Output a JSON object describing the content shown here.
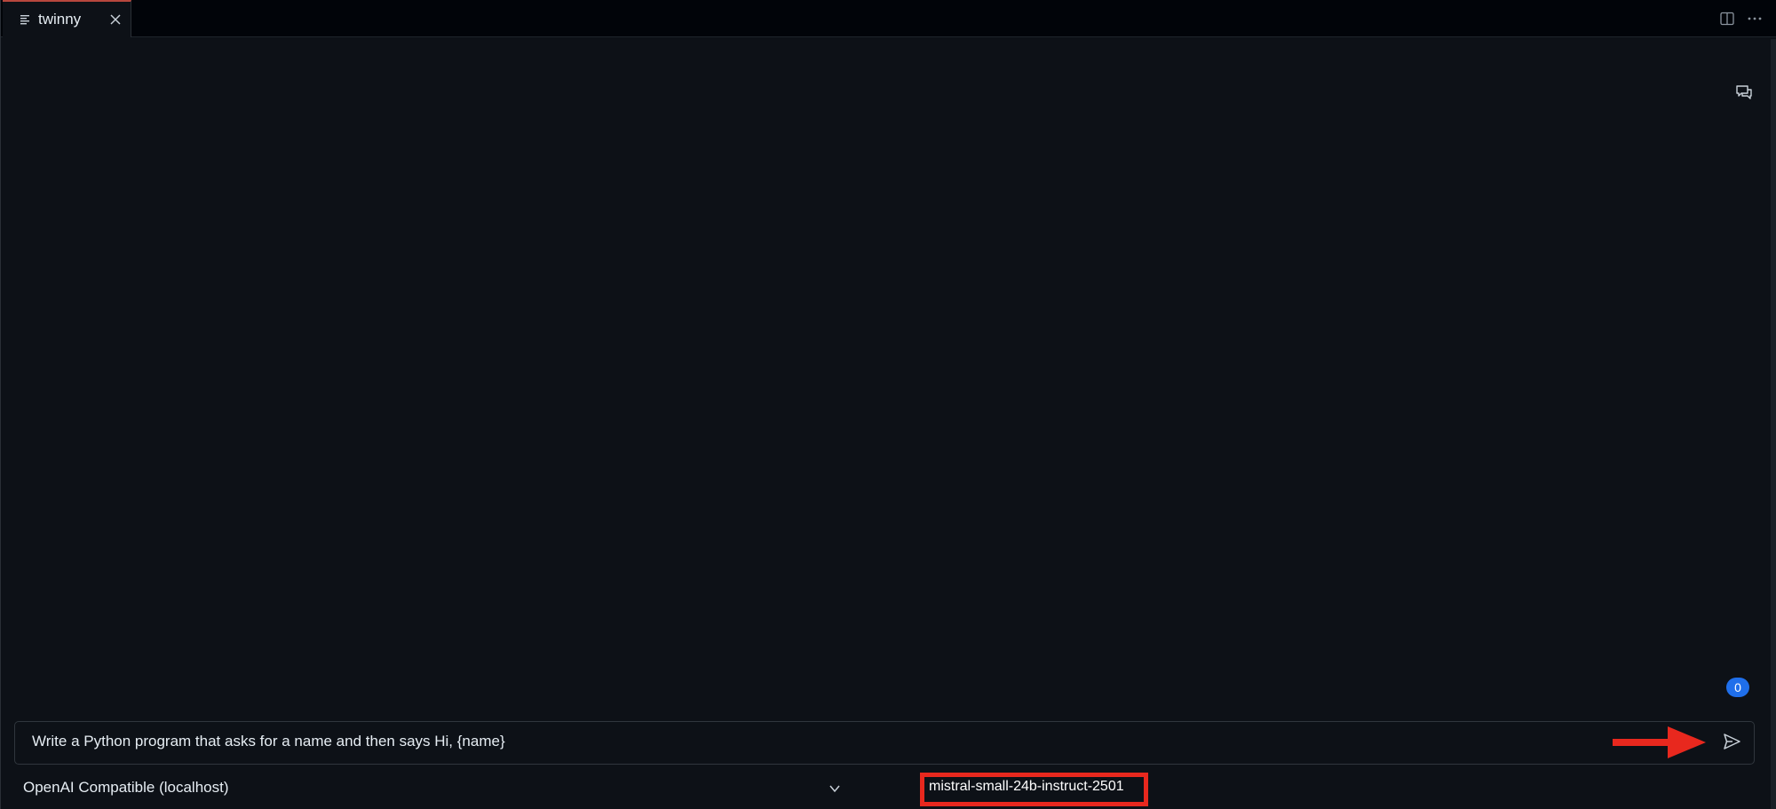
{
  "tab": {
    "label": "twinny",
    "icon": "lines-icon",
    "close_icon": "close-icon"
  },
  "toolbar": {
    "split_icon": "split-editor-icon",
    "more_icon": "more-icon"
  },
  "chat": {
    "history_icon": "chat-history-icon",
    "token_count": "0",
    "input_value": "Write a Python program that asks for a name and then says Hi, {name}",
    "send_icon": "send-icon"
  },
  "footer": {
    "provider_value": "OpenAI Compatible (localhost)",
    "model_value": "mistral-small-24b-instruct-2501"
  },
  "colors": {
    "background": "#0d1117",
    "tabbar": "#010409",
    "annotation_red": "#e8281e",
    "badge_blue": "#1f6feb",
    "tab_accent": "#b8473d"
  }
}
